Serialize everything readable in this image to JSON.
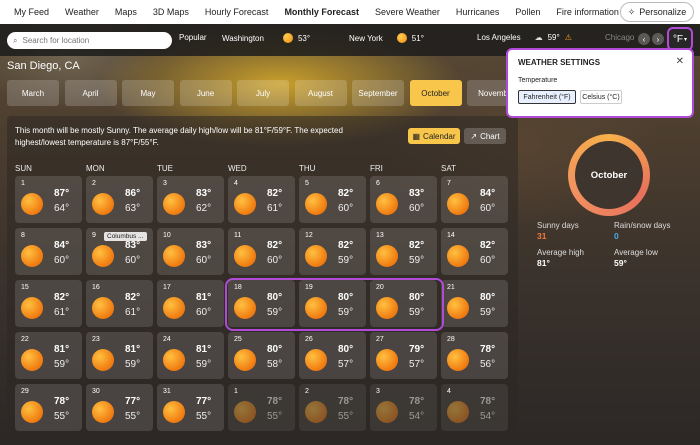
{
  "nav": {
    "items": [
      "My Feed",
      "Weather",
      "Maps",
      "3D Maps",
      "Hourly Forecast",
      "Monthly Forecast",
      "Severe Weather",
      "Hurricanes",
      "Pollen",
      "Fire information",
      "···"
    ],
    "personalize": "Personalize"
  },
  "search": {
    "placeholder": "Search for location",
    "popular": "Popular"
  },
  "locations": [
    {
      "name": "Washington",
      "temp": "53°"
    },
    {
      "name": "New York",
      "temp": "51°"
    },
    {
      "name": "Los Angeles",
      "temp": "59°"
    },
    {
      "name": "Chicago",
      "temp": ""
    }
  ],
  "unit_selector": "°F",
  "city": "San Diego, CA",
  "months": [
    "March",
    "April",
    "May",
    "June",
    "July",
    "August",
    "September",
    "October",
    "Novemb"
  ],
  "active_month": "October",
  "summary": "This month will be mostly Sunny. The average daily high/low will be 81°F/59°F. The expected highest/lowest temperature is 87°F/55°F.",
  "view": {
    "calendar": "Calendar",
    "chart": "Chart"
  },
  "weekdays": [
    "SUN",
    "MON",
    "TUE",
    "WED",
    "THU",
    "FRI",
    "SAT"
  ],
  "days": [
    {
      "d": "1",
      "hi": "87°",
      "lo": "64°"
    },
    {
      "d": "2",
      "hi": "86°",
      "lo": "63°"
    },
    {
      "d": "3",
      "hi": "83°",
      "lo": "62°"
    },
    {
      "d": "4",
      "hi": "82°",
      "lo": "61°"
    },
    {
      "d": "5",
      "hi": "82°",
      "lo": "60°"
    },
    {
      "d": "6",
      "hi": "83°",
      "lo": "60°"
    },
    {
      "d": "7",
      "hi": "84°",
      "lo": "60°"
    },
    {
      "d": "8",
      "hi": "84°",
      "lo": "60°"
    },
    {
      "d": "9",
      "hi": "83°",
      "lo": "60°",
      "holiday": "Columbus ..."
    },
    {
      "d": "10",
      "hi": "83°",
      "lo": "60°"
    },
    {
      "d": "11",
      "hi": "82°",
      "lo": "60°"
    },
    {
      "d": "12",
      "hi": "82°",
      "lo": "59°"
    },
    {
      "d": "13",
      "hi": "82°",
      "lo": "59°"
    },
    {
      "d": "14",
      "hi": "82°",
      "lo": "60°"
    },
    {
      "d": "15",
      "hi": "82°",
      "lo": "61°"
    },
    {
      "d": "16",
      "hi": "82°",
      "lo": "61°"
    },
    {
      "d": "17",
      "hi": "81°",
      "lo": "60°"
    },
    {
      "d": "18",
      "hi": "80°",
      "lo": "59°"
    },
    {
      "d": "19",
      "hi": "80°",
      "lo": "59°"
    },
    {
      "d": "20",
      "hi": "80°",
      "lo": "59°"
    },
    {
      "d": "21",
      "hi": "80°",
      "lo": "59°"
    },
    {
      "d": "22",
      "hi": "81°",
      "lo": "59°"
    },
    {
      "d": "23",
      "hi": "81°",
      "lo": "59°"
    },
    {
      "d": "24",
      "hi": "81°",
      "lo": "59°"
    },
    {
      "d": "25",
      "hi": "80°",
      "lo": "58°"
    },
    {
      "d": "26",
      "hi": "80°",
      "lo": "57°"
    },
    {
      "d": "27",
      "hi": "79°",
      "lo": "57°"
    },
    {
      "d": "28",
      "hi": "78°",
      "lo": "56°"
    },
    {
      "d": "29",
      "hi": "78°",
      "lo": "55°"
    },
    {
      "d": "30",
      "hi": "77°",
      "lo": "55°"
    },
    {
      "d": "31",
      "hi": "77°",
      "lo": "55°"
    },
    {
      "d": "1",
      "hi": "78°",
      "lo": "55°",
      "faded": true
    },
    {
      "d": "2",
      "hi": "78°",
      "lo": "55°",
      "faded": true
    },
    {
      "d": "3",
      "hi": "78°",
      "lo": "54°",
      "faded": true
    },
    {
      "d": "4",
      "hi": "78°",
      "lo": "54°",
      "faded": true
    }
  ],
  "stats": {
    "month": "October",
    "sunny_label": "Sunny days",
    "sunny": "31",
    "rain_label": "Rain/snow days",
    "rain": "0",
    "avg_high_label": "Average high",
    "avg_high": "81°",
    "avg_low_label": "Average low",
    "avg_low": "59°"
  },
  "settings": {
    "title": "WEATHER SETTINGS",
    "temperature_label": "Temperature",
    "fahrenheit": "Fahrenheit (°F)",
    "celsius": "Celsius (°C)"
  }
}
